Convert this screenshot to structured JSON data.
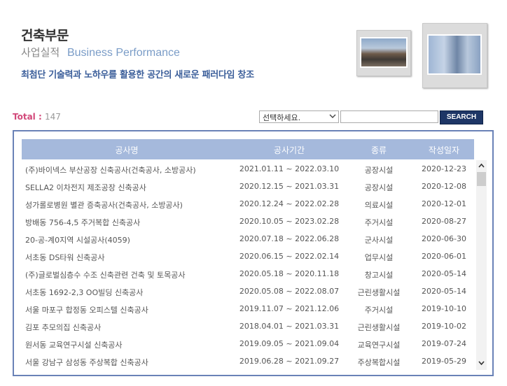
{
  "header": {
    "title": "건축부문",
    "subtitle_kr": "사업실적",
    "subtitle_en": "Business Performance",
    "slogan": "최첨단 기술력과 노하우를 활용한 공간의 새로운 패러다임 창조"
  },
  "total": {
    "label": "Total :",
    "count": "147"
  },
  "search": {
    "select_value": "선택하세요.",
    "input_value": "",
    "button_label": "SEARCH"
  },
  "table": {
    "columns": [
      "공사명",
      "공사기간",
      "종류",
      "작성일자"
    ],
    "rows": [
      [
        "(주)바이넥스 부산공장 신축공사(건축공사, 소방공사)",
        "2021.01.11 ~ 2022.03.10",
        "공장시설",
        "2020-12-23"
      ],
      [
        "SELLA2 이차전지 제조공장 신축공사",
        "2020.12.15 ~ 2021.03.31",
        "공장시설",
        "2020-12-08"
      ],
      [
        "성가롤로병원 별관 증축공사(건축공사, 소방공사)",
        "2020.12.24 ~ 2022.02.28",
        "의료시설",
        "2020-12-01"
      ],
      [
        "방배동 756-4,5 주거복합 신축공사",
        "2020.10.05 ~ 2023.02.28",
        "주거시설",
        "2020-08-27"
      ],
      [
        "20-공-계0지역 시설공사(4059)",
        "2020.07.18 ~ 2022.06.28",
        "군사시설",
        "2020-06-30"
      ],
      [
        "서초동 DS타워 신축공사",
        "2020.06.15 ~ 2022.02.14",
        "업무시설",
        "2020-06-01"
      ],
      [
        "(주)글로벌심층수 수조 신축관련 건축 및 토목공사",
        "2020.05.18 ~ 2020.11.18",
        "창고시설",
        "2020-05-14"
      ],
      [
        "서초동 1692-2,3 OO빌딩 신축공사",
        "2020.05.08 ~ 2022.08.07",
        "근린생활시설",
        "2020-05-14"
      ],
      [
        "서울 마포구 합정동 오피스텔 신축공사",
        "2019.11.07 ~ 2021.12.06",
        "주거시설",
        "2019-10-10"
      ],
      [
        "김포 추모의집 신축공사",
        "2018.04.01 ~ 2021.03.31",
        "근린생활시설",
        "2019-10-02"
      ],
      [
        "원서동 교육연구시설 신축공사",
        "2019.09.05 ~ 2021.09.04",
        "교육연구시설",
        "2019-07-24"
      ],
      [
        "서울 강남구 삼성동 주상복합 신축공사",
        "2019.06.28 ~ 2021.09.27",
        "주상복합시설",
        "2019-05-29"
      ]
    ]
  },
  "colors": {
    "accent": "#1e3666",
    "header_bg": "#a5b9dc",
    "panel_border": "#6a82b7",
    "total_label": "#d2497a",
    "slogan": "#3b5e9a"
  },
  "icons": {
    "select": "chevron-down-icon",
    "scroll_up": "arrow-up-icon",
    "scroll_down": "arrow-down-icon"
  }
}
